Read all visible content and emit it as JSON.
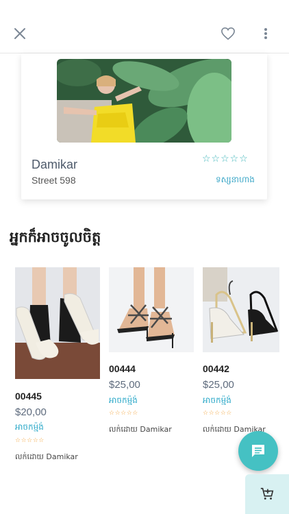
{
  "header": {
    "close_icon": "close-icon",
    "favorite_icon": "heart-icon",
    "more_icon": "more-vertical-icon"
  },
  "store": {
    "name": "Damikar",
    "address": "Street 598",
    "rating_stars": "☆☆☆☆☆",
    "rating_value": 0,
    "link_text": "ទស្សនាហាង",
    "accent": "#3cb4b9"
  },
  "section": {
    "title": "អ្នកក៏អាចចូលចិត្ត"
  },
  "products": [
    {
      "code": "00445",
      "price": "$20,00",
      "status": "អាចកម្ម៉ង់",
      "stars": "☆☆☆☆☆",
      "seller": "លក់ដោយ Damikar"
    },
    {
      "code": "00444",
      "price": "$25,00",
      "status": "អាចកម្ម៉ង់",
      "stars": "☆☆☆☆☆",
      "seller": "លក់ដោយ Damikar"
    },
    {
      "code": "00442",
      "price": "$25,00",
      "status": "អាចកម្ម៉ង់",
      "stars": "☆☆☆☆☆",
      "seller": "លក់ដោយ Damikar"
    }
  ],
  "fab": {
    "chat_icon": "chat-icon",
    "cart_icon": "add-to-cart-icon",
    "color": "#45c1c3"
  }
}
